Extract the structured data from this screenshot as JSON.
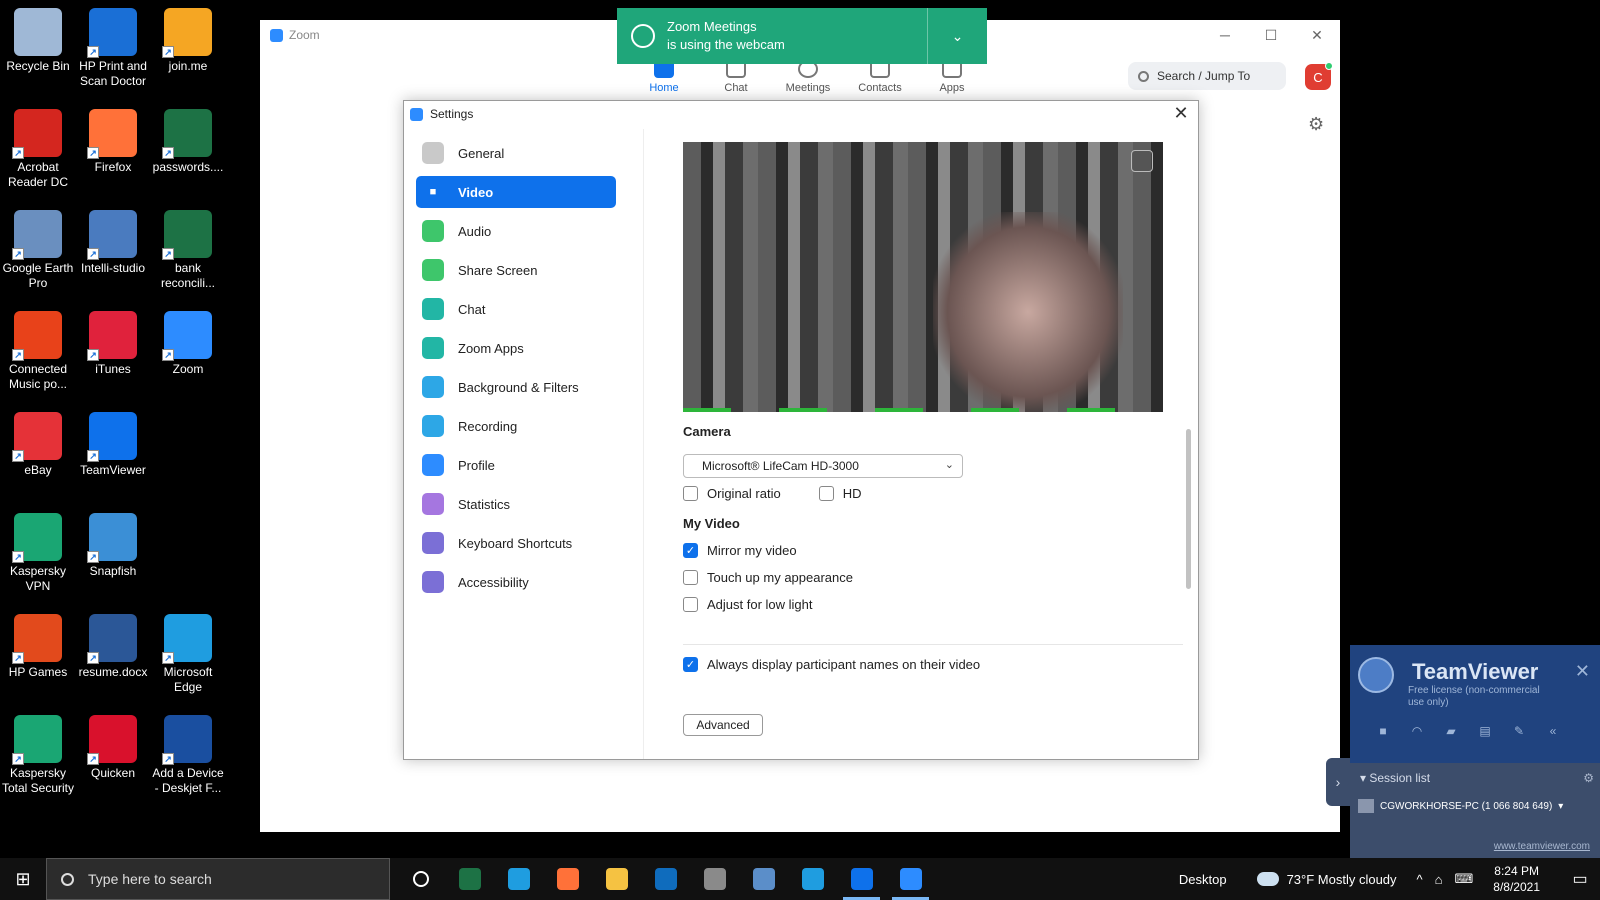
{
  "desktop": {
    "icons": [
      {
        "label": "Recycle Bin",
        "icon": "recycle-bin-icon",
        "color": "#9fb8d6"
      },
      {
        "label": "HP Print and Scan Doctor",
        "icon": "hp-icon",
        "color": "#1a6fd6"
      },
      {
        "label": "join.me",
        "icon": "joinme-icon",
        "color": "#f5a623"
      },
      {
        "label": "Acrobat Reader DC",
        "icon": "acrobat-icon",
        "color": "#d4261f"
      },
      {
        "label": "Firefox",
        "icon": "firefox-icon",
        "color": "#ff7139"
      },
      {
        "label": "passwords....",
        "icon": "excel-icon",
        "color": "#1d7245"
      },
      {
        "label": "Google Earth Pro",
        "icon": "google-earth-icon",
        "color": "#6a8fbf"
      },
      {
        "label": "Intelli-studio",
        "icon": "intelli-studio-icon",
        "color": "#4a7bbf"
      },
      {
        "label": "bank reconcili...",
        "icon": "excel-icon",
        "color": "#1d7245"
      },
      {
        "label": "Connected Music po...",
        "icon": "music-icon",
        "color": "#e8421a"
      },
      {
        "label": "iTunes",
        "icon": "itunes-icon",
        "color": "#e0223c"
      },
      {
        "label": "Zoom",
        "icon": "zoom-icon",
        "color": "#2d8cff"
      },
      {
        "label": "eBay",
        "icon": "ebay-icon",
        "color": "#e53238"
      },
      {
        "label": "TeamViewer",
        "icon": "teamviewer-icon",
        "color": "#0e71eb"
      },
      {
        "label": "",
        "icon": "",
        "color": ""
      },
      {
        "label": "Kaspersky VPN",
        "icon": "kaspersky-vpn-icon",
        "color": "#1aa673"
      },
      {
        "label": "Snapfish",
        "icon": "snapfish-icon",
        "color": "#3b8fd6"
      },
      {
        "label": "",
        "icon": "",
        "color": ""
      },
      {
        "label": "HP Games",
        "icon": "hp-games-icon",
        "color": "#e24a1c"
      },
      {
        "label": "resume.docx",
        "icon": "word-icon",
        "color": "#2b5797"
      },
      {
        "label": "Microsoft Edge",
        "icon": "edge-icon",
        "color": "#1f9de0"
      },
      {
        "label": "Kaspersky Total Security",
        "icon": "kaspersky-icon",
        "color": "#1aa673"
      },
      {
        "label": "Quicken",
        "icon": "quicken-icon",
        "color": "#d9112c"
      },
      {
        "label": "Add a Device - Deskjet F...",
        "icon": "hp-device-icon",
        "color": "#1a4fa0"
      }
    ]
  },
  "zoom": {
    "title": "Zoom",
    "nav": [
      {
        "label": "Home",
        "active": true
      },
      {
        "label": "Chat",
        "active": false
      },
      {
        "label": "Meetings",
        "active": false
      },
      {
        "label": "Contacts",
        "active": false
      },
      {
        "label": "Apps",
        "active": false
      }
    ],
    "search_placeholder": "Search / Jump To",
    "avatar_letter": "C",
    "accent": "#0e71eb"
  },
  "banner": {
    "line1": "Zoom Meetings",
    "line2": "is using the webcam",
    "color": "#1fa67a"
  },
  "settings": {
    "title": "Settings",
    "sidebar": [
      {
        "label": "General",
        "icon": "gear-icon",
        "color": "#c9c9c9"
      },
      {
        "label": "Video",
        "icon": "video-camera-icon",
        "color": "#ffffff"
      },
      {
        "label": "Audio",
        "icon": "headphones-icon",
        "color": "#3ec66b"
      },
      {
        "label": "Share Screen",
        "icon": "share-screen-icon",
        "color": "#3ec66b"
      },
      {
        "label": "Chat",
        "icon": "chat-bubble-icon",
        "color": "#22b6a5"
      },
      {
        "label": "Zoom Apps",
        "icon": "zoom-apps-icon",
        "color": "#22b6a5"
      },
      {
        "label": "Background & Filters",
        "icon": "background-icon",
        "color": "#2da7e6"
      },
      {
        "label": "Recording",
        "icon": "recording-icon",
        "color": "#2da7e6"
      },
      {
        "label": "Profile",
        "icon": "profile-icon",
        "color": "#2d8cff"
      },
      {
        "label": "Statistics",
        "icon": "statistics-icon",
        "color": "#a576e0"
      },
      {
        "label": "Keyboard Shortcuts",
        "icon": "keyboard-icon",
        "color": "#7b6fd6"
      },
      {
        "label": "Accessibility",
        "icon": "accessibility-icon",
        "color": "#7b6fd6"
      }
    ],
    "camera_label": "Camera",
    "camera_value": "Microsoft® LifeCam HD-3000",
    "original_ratio": "Original ratio",
    "hd": "HD",
    "my_video_label": "My Video",
    "mirror": "Mirror my video",
    "touch_up": "Touch up my appearance",
    "low_light": "Adjust for low light",
    "display_names": "Always display participant names on their video",
    "advanced": "Advanced"
  },
  "teamviewer": {
    "name": "TeamViewer",
    "license": "Free license (non-commercial use only)",
    "session_list": "Session list",
    "session_item": "CGWORKHORSE-PC (1 066 804 649)",
    "link": "www.teamviewer.com"
  },
  "taskbar": {
    "search_placeholder": "Type here to search",
    "desktop_label": "Desktop",
    "weather": "73°F  Mostly cloudy",
    "time": "8:24 PM",
    "date": "8/8/2021",
    "apps": [
      {
        "name": "task-view-icon",
        "color": "#111111"
      },
      {
        "name": "excel-icon",
        "color": "#1d7245"
      },
      {
        "name": "edge-icon",
        "color": "#1f9de0"
      },
      {
        "name": "firefox-icon",
        "color": "#ff7139"
      },
      {
        "name": "file-explorer-icon",
        "color": "#f5c242"
      },
      {
        "name": "outlook-icon",
        "color": "#0f6cbd"
      },
      {
        "name": "camera-icon",
        "color": "#8a8a8a"
      },
      {
        "name": "calculator-icon",
        "color": "#5b8ec9"
      },
      {
        "name": "store-icon",
        "color": "#1f9de0"
      },
      {
        "name": "teamviewer-icon",
        "color": "#0e71eb"
      },
      {
        "name": "zoom-icon",
        "color": "#2d8cff"
      }
    ]
  }
}
